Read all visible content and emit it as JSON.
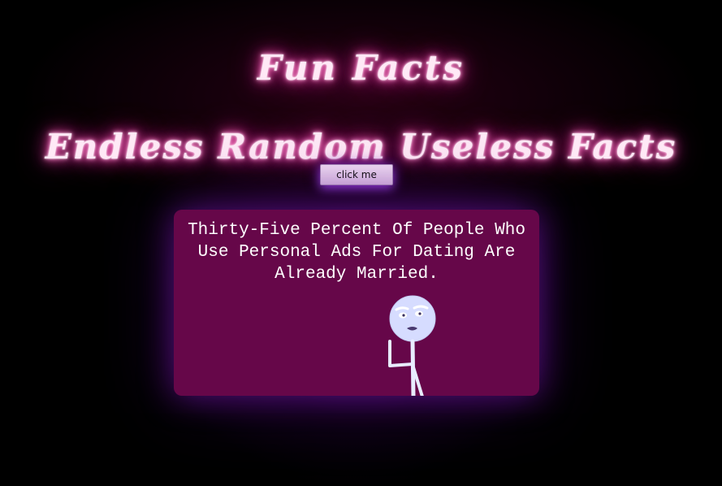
{
  "header": {
    "title": "Fun Facts",
    "subtitle": "Endless Random Useless Facts"
  },
  "controls": {
    "button_label": "click me"
  },
  "fact_card": {
    "text": "Thirty-Five Percent Of People Who Use Personal Ads For Dating Are Already Married.",
    "illustration_icon": "stick-figure-drawing"
  },
  "colors": {
    "background": "#000000",
    "card": "#660749",
    "neon_glow": "#ff5fb8",
    "button": "#e4c8ec",
    "figure": "#d6dcff"
  }
}
